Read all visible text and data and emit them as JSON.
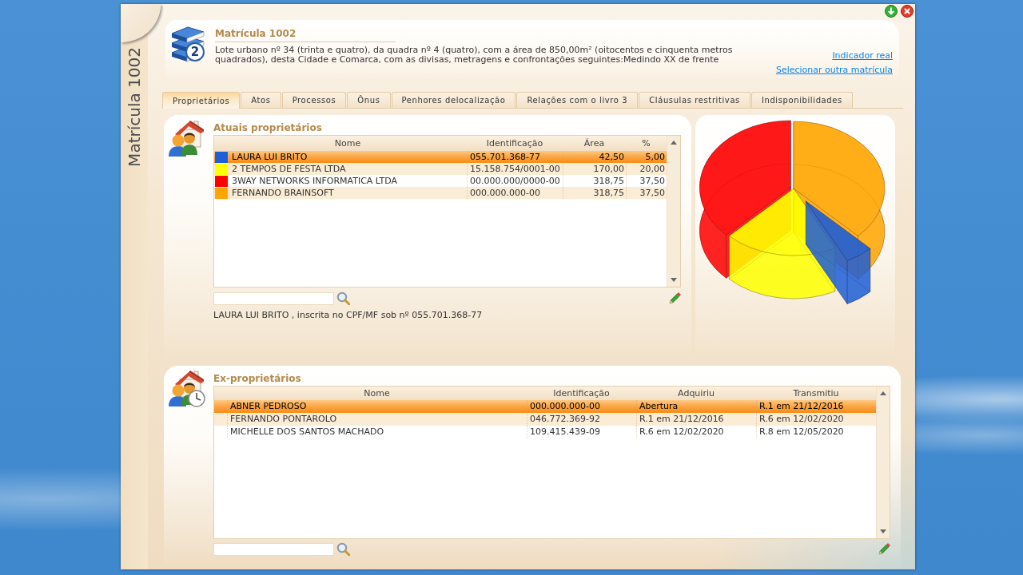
{
  "window": {
    "side_title": "Matrícula 1002"
  },
  "header": {
    "title": "Matrícula 1002",
    "badge": "2",
    "description": "Lote urbano nº 34 (trinta e quatro), da quadra nº 4 (quatro), com a área de 850,00m² (oitocentos e cinquenta metros quadrados), desta Cidade e Comarca, com as divisas, metragens e confrontações seguintes:Medindo XX de frente",
    "links": [
      "Indicador real",
      "Selecionar outra matrícula"
    ]
  },
  "tabs": [
    {
      "label": "Proprietários",
      "selected": true
    },
    {
      "label": "Atos",
      "selected": false
    },
    {
      "label": "Processos",
      "selected": false
    },
    {
      "label": "Ônus",
      "selected": false
    },
    {
      "label": "Penhores delocalização",
      "selected": false
    },
    {
      "label": "Relações com o livro 3",
      "selected": false
    },
    {
      "label": "Cláusulas restritivas",
      "selected": false
    },
    {
      "label": "Indisponibilidades",
      "selected": false
    }
  ],
  "current_owners": {
    "title": "Atuais proprietários",
    "columns": [
      "Nome",
      "Identificação",
      "Área",
      "%"
    ],
    "rows": [
      {
        "color": "#1e5ed6",
        "name": "LAURA LUI BRITO",
        "identification": "055.701.368-77",
        "area": "42,50",
        "percent": "5,00",
        "selected": true
      },
      {
        "color": "#ffff00",
        "name": "2 TEMPOS DE FESTA LTDA",
        "identification": "15.158.754/0001-00",
        "area": "170,00",
        "percent": "20,00",
        "selected": false
      },
      {
        "color": "#ff0000",
        "name": "3WAY NETWORKS INFORMATICA LTDA",
        "identification": "00.000.000/0000-00",
        "area": "318,75",
        "percent": "37,50",
        "selected": false
      },
      {
        "color": "#ffa500",
        "name": "FERNANDO BRAINSOFT",
        "identification": "000.000.000-00",
        "area": "318,75",
        "percent": "37,50",
        "selected": false
      }
    ],
    "summary": "LAURA LUI BRITO , inscrita no CPF/MF sob nº 055.701.368-77"
  },
  "former_owners": {
    "title": "Ex-proprietários",
    "columns": [
      "Nome",
      "Identificação",
      "Adquiriu",
      "Transmitiu"
    ],
    "rows": [
      {
        "name": "ABNER PEDROSO",
        "identification": "000.000.000-00",
        "acquired": "Abertura",
        "transmitted": "R.1 em 21/12/2016",
        "selected": true
      },
      {
        "name": "FERNANDO PONTAROLO",
        "identification": "046.772.369-92",
        "acquired": "R.1 em 21/12/2016",
        "transmitted": "R.6 em 12/02/2020",
        "selected": false
      },
      {
        "name": "MICHELLE DOS SANTOS MACHADO",
        "identification": "109.415.439-09",
        "acquired": "R.6 em 12/02/2020",
        "transmitted": "R.8 em 12/05/2020",
        "selected": false
      }
    ]
  }
}
